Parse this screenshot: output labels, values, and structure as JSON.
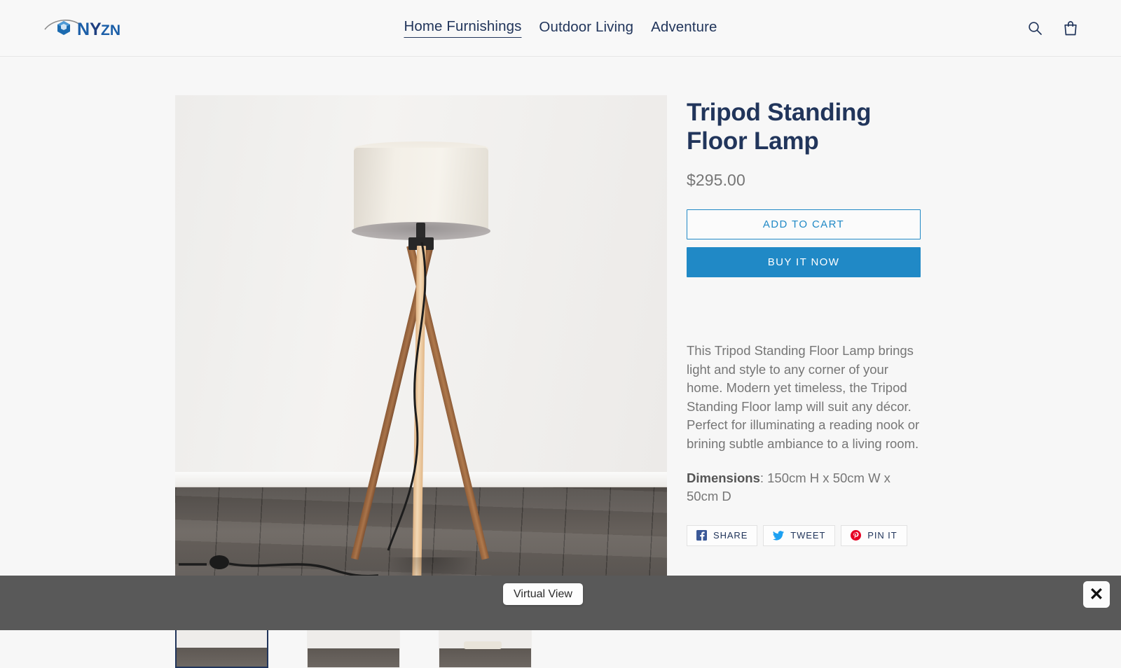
{
  "header": {
    "logo_text": "Nyzn",
    "logo_icon": "hex-cube-eye-logo",
    "nav": [
      {
        "label": "Home Furnishings",
        "active": true
      },
      {
        "label": "Outdoor Living",
        "active": false
      },
      {
        "label": "Adventure",
        "active": false
      }
    ],
    "search_icon": "search-icon",
    "cart_icon": "shopping-bag-icon"
  },
  "product": {
    "title": "Tripod Standing Floor Lamp",
    "price": "$295.00",
    "add_to_cart_label": "ADD TO CART",
    "buy_now_label": "BUY IT NOW",
    "description": "This Tripod Standing Floor Lamp brings light and style to any corner of your home. Modern yet timeless, the Tripod Standing Floor lamp will suit any décor. Perfect for illuminating a reading nook or brining subtle ambiance to a living room.",
    "dimensions_label": "Dimensions",
    "dimensions_value": ": 150cm H x 50cm W x 50cm D",
    "image_alt": "tripod-floor-lamp-photo"
  },
  "share": {
    "facebook_label": "SHARE",
    "twitter_label": "TWEET",
    "pinterest_label": "PIN IT"
  },
  "gallery": {
    "thumbnails": [
      {
        "name": "thumbnail-1",
        "selected": true
      },
      {
        "name": "thumbnail-2",
        "selected": false
      },
      {
        "name": "thumbnail-3",
        "selected": false
      }
    ]
  },
  "overlay": {
    "virtual_view_label": "Virtual View",
    "close_label": "✕"
  },
  "colors": {
    "brand_navy": "#21355b",
    "accent_blue": "#2089c6",
    "price_gray": "#767676",
    "overlay_gray": "#595959",
    "facebook_blue": "#3b5998",
    "twitter_blue": "#1da1f2",
    "pinterest_red": "#e60023"
  }
}
